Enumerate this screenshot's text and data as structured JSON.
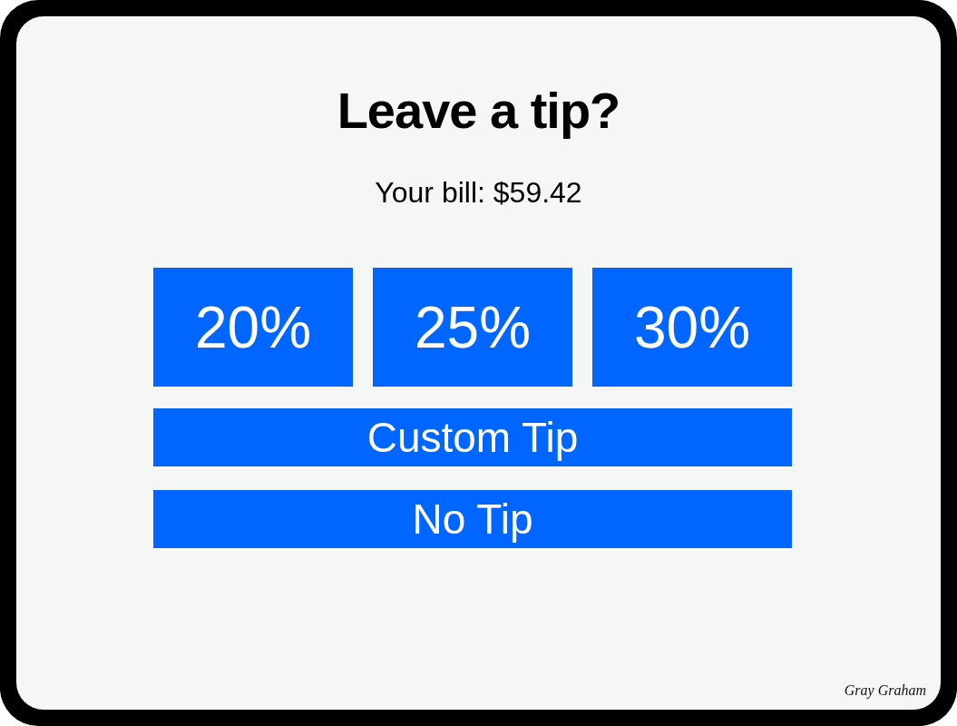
{
  "title": "Leave a tip?",
  "bill": "Your bill: $59.42",
  "tip_options": [
    {
      "label": "20%"
    },
    {
      "label": "25%"
    },
    {
      "label": "30%"
    }
  ],
  "actions": [
    {
      "label": "Custom Tip"
    },
    {
      "label": "No Tip"
    }
  ],
  "signature": "Gray Graham"
}
